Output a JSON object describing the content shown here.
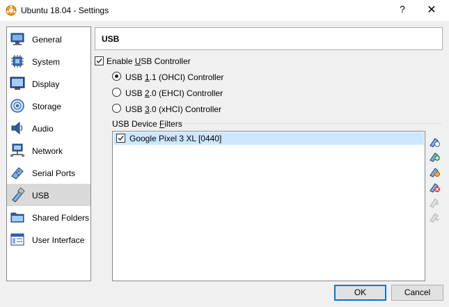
{
  "window": {
    "title": "Ubuntu 18.04 - Settings",
    "help_label": "?",
    "close_label": "✕"
  },
  "sidebar": {
    "items": [
      {
        "label": "General",
        "icon": "monitor-icon"
      },
      {
        "label": "System",
        "icon": "chip-icon"
      },
      {
        "label": "Display",
        "icon": "display-icon"
      },
      {
        "label": "Storage",
        "icon": "storage-disc-icon"
      },
      {
        "label": "Audio",
        "icon": "speaker-icon"
      },
      {
        "label": "Network",
        "icon": "network-icon"
      },
      {
        "label": "Serial Ports",
        "icon": "serial-port-icon"
      },
      {
        "label": "USB",
        "icon": "usb-icon",
        "selected": true
      },
      {
        "label": "Shared Folders",
        "icon": "shared-folder-icon"
      },
      {
        "label": "User Interface",
        "icon": "user-interface-icon"
      }
    ]
  },
  "section": {
    "title": "USB"
  },
  "usb": {
    "enable_controller": {
      "pre": "Enable ",
      "mnemonic": "U",
      "post": "SB Controller",
      "checked": true
    },
    "controllers": [
      {
        "pre": "USB ",
        "mnemonic": "1",
        "post": ".1 (OHCI) Controller",
        "selected": true
      },
      {
        "pre": "USB ",
        "mnemonic": "2",
        "post": ".0 (EHCI) Controller",
        "selected": false
      },
      {
        "pre": "USB ",
        "mnemonic": "3",
        "post": ".0 (xHCI) Controller",
        "selected": false
      }
    ],
    "filters_label": {
      "pre": "USB Device ",
      "mnemonic": "F",
      "post": "ilters"
    },
    "filters": [
      {
        "label": "Google Pixel 3 XL [0440]",
        "checked": true
      }
    ],
    "tools": [
      {
        "icon": "add-empty-filter-icon",
        "enabled": true
      },
      {
        "icon": "add-filter-from-device-icon",
        "enabled": true
      },
      {
        "icon": "edit-filter-icon",
        "enabled": true
      },
      {
        "icon": "remove-filter-icon",
        "enabled": true
      },
      {
        "icon": "move-filter-up-icon",
        "enabled": false
      },
      {
        "icon": "move-filter-down-icon",
        "enabled": false
      }
    ]
  },
  "buttons": {
    "ok": "OK",
    "cancel": "Cancel"
  }
}
